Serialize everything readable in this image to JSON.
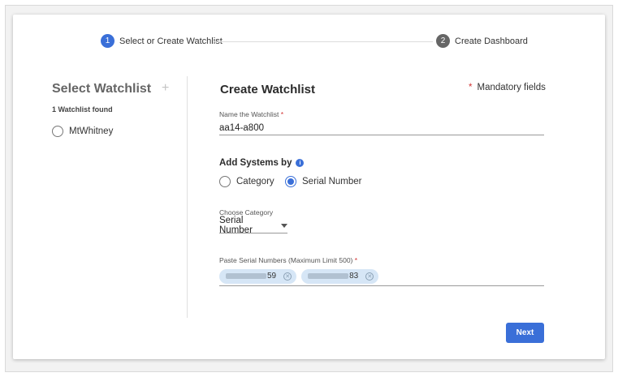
{
  "stepper": {
    "step1": {
      "num": "1",
      "label": "Select or Create Watchlist",
      "color": "#3a6fd8"
    },
    "step2": {
      "num": "2",
      "label": "Create Dashboard",
      "color": "#666666"
    }
  },
  "left_panel": {
    "title": "Select Watchlist",
    "add_icon": "plus-icon",
    "count_text": "1 Watchlist found",
    "items": [
      {
        "label": "MtWhitney",
        "selected": false
      }
    ]
  },
  "form": {
    "title": "Create Watchlist",
    "mandatory_star": "*",
    "mandatory_text": "Mandatory fields",
    "name_label": "Name the Watchlist",
    "required_mark": "*",
    "name_value": "aa14-a800",
    "add_by_label": "Add Systems by",
    "add_by_info_icon": "info-icon",
    "options": [
      {
        "label": "Category",
        "selected": false
      },
      {
        "label": "Serial Number",
        "selected": true
      }
    ],
    "category_label": "Choose Category",
    "category_value": "Serial Number",
    "serials_label": "Paste Serial Numbers (Maximum Limit 500)",
    "serials": [
      {
        "suffix": "59"
      },
      {
        "suffix": "83"
      }
    ],
    "next_label": "Next"
  },
  "colors": {
    "accent": "#3a6fd8",
    "required": "#d23333",
    "chip": "#d6e6f6"
  }
}
